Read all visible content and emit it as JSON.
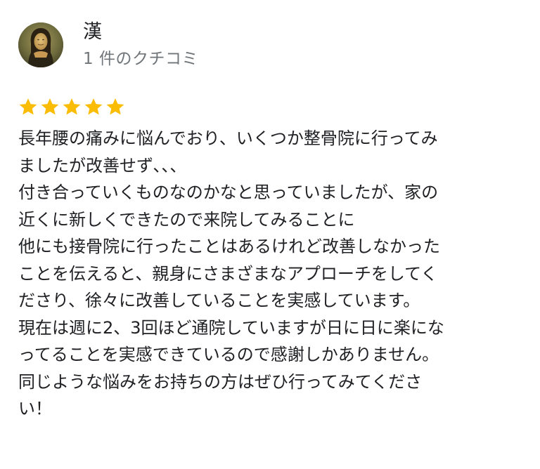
{
  "author": {
    "name": "漢",
    "review_count": "1 件のクチコミ",
    "avatar_icon": "mona-lisa-avatar-icon"
  },
  "rating": {
    "stars": 5,
    "max": 5,
    "star_color": "#fbbc04",
    "star_icon": "star-icon"
  },
  "review": {
    "lines": [
      "長年腰の痛みに悩んでおり、いくつか整骨院に行ってみ",
      "ましたが改善せず､､､",
      "付き合っていくものなのかなと思っていましたが、家の",
      "近くに新しくできたので来院してみることに",
      "他にも接骨院に行ったことはあるけれど改善しなかった",
      "ことを伝えると、親身にさまざまなアプローチをしてく",
      "ださり、徐々に改善していることを実感しています。",
      "現在は週に2、3回ほど通院していますが日に日に楽にな",
      "ってることを実感できているので感謝しかありません。",
      "同じような悩みをお持ちの方はぜひ行ってみてくださ",
      "い！"
    ]
  },
  "colors": {
    "text": "#202124",
    "secondary_text": "#70757a",
    "background": "#ffffff"
  }
}
